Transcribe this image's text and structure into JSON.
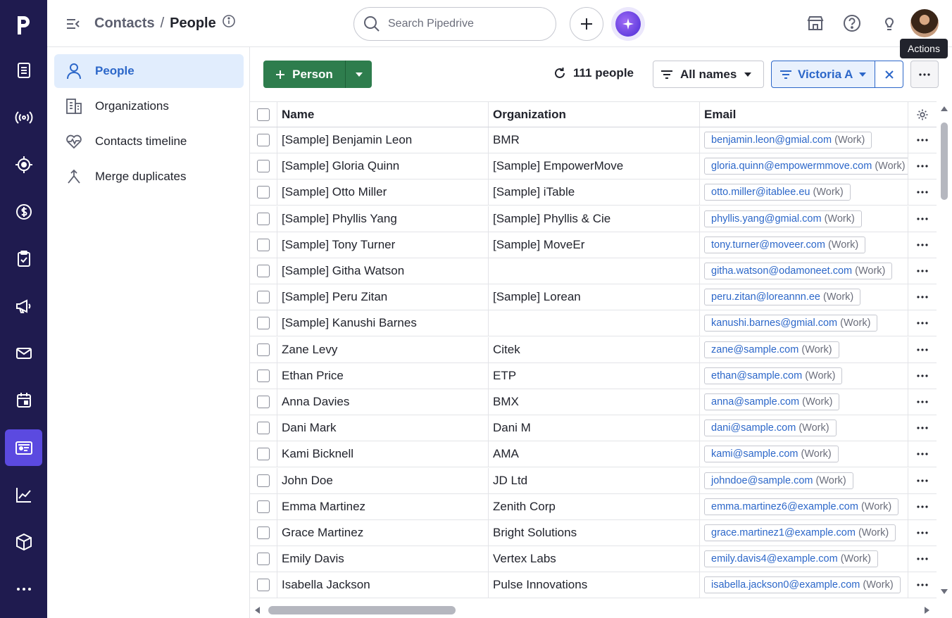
{
  "app": {
    "brand_letter": "p"
  },
  "rail": {
    "items": [
      {
        "name": "leads-icon"
      },
      {
        "name": "campaigns-signal-icon"
      },
      {
        "name": "target-icon"
      },
      {
        "name": "deals-dollar-icon"
      },
      {
        "name": "activities-checklist-icon"
      },
      {
        "name": "megaphone-icon"
      },
      {
        "name": "mail-icon"
      },
      {
        "name": "calendar-icon"
      },
      {
        "name": "contacts-card-icon",
        "active": true
      },
      {
        "name": "insights-chart-icon"
      },
      {
        "name": "products-box-icon"
      },
      {
        "name": "more-dots-icon"
      }
    ]
  },
  "header": {
    "breadcrumb_parent": "Contacts",
    "breadcrumb_sep": "/",
    "breadcrumb_current": "People",
    "search_placeholder": "Search Pipedrive",
    "tooltip": "Actions"
  },
  "sidenav": {
    "items": [
      {
        "label": "People",
        "active": true
      },
      {
        "label": "Organizations"
      },
      {
        "label": "Contacts timeline"
      },
      {
        "label": "Merge duplicates"
      }
    ]
  },
  "toolbar": {
    "add_label": "Person",
    "count_label": "111 people",
    "names_filter": "All names",
    "owner_filter": "Victoria A"
  },
  "table": {
    "columns": {
      "name": "Name",
      "organization": "Organization",
      "email": "Email"
    },
    "email_type": "(Work)",
    "rows": [
      {
        "name": "[Sample] Benjamin Leon",
        "org": "BMR",
        "email": "benjamin.leon@gmial.com"
      },
      {
        "name": "[Sample] Gloria Quinn",
        "org": "[Sample] EmpowerMove",
        "email": "gloria.quinn@empowermmove.com"
      },
      {
        "name": "[Sample] Otto Miller",
        "org": "[Sample] iTable",
        "email": "otto.miller@itablee.eu"
      },
      {
        "name": "[Sample] Phyllis Yang",
        "org": "[Sample] Phyllis & Cie",
        "email": "phyllis.yang@gmial.com"
      },
      {
        "name": "[Sample] Tony Turner",
        "org": "[Sample] MoveEr",
        "email": "tony.turner@moveer.com"
      },
      {
        "name": "[Sample] Githa Watson",
        "org": "",
        "email": "githa.watson@odamoneet.com"
      },
      {
        "name": "[Sample] Peru Zitan",
        "org": "[Sample] Lorean",
        "email": "peru.zitan@loreannn.ee"
      },
      {
        "name": "[Sample] Kanushi Barnes",
        "org": "",
        "email": "kanushi.barnes@gmial.com"
      },
      {
        "name": "Zane Levy",
        "org": "Citek",
        "email": "zane@sample.com"
      },
      {
        "name": "Ethan Price",
        "org": "ETP",
        "email": "ethan@sample.com"
      },
      {
        "name": "Anna Davies",
        "org": "BMX",
        "email": "anna@sample.com"
      },
      {
        "name": "Dani Mark",
        "org": "Dani M",
        "email": "dani@sample.com"
      },
      {
        "name": "Kami Bicknell",
        "org": "AMA",
        "email": "kami@sample.com"
      },
      {
        "name": "John Doe",
        "org": "JD Ltd",
        "email": "johndoe@sample.com"
      },
      {
        "name": "Emma Martinez",
        "org": "Zenith Corp",
        "email": "emma.martinez6@example.com"
      },
      {
        "name": "Grace Martinez",
        "org": "Bright Solutions",
        "email": "grace.martinez1@example.com"
      },
      {
        "name": "Emily Davis",
        "org": "Vertex Labs",
        "email": "emily.davis4@example.com"
      },
      {
        "name": "Isabella Jackson",
        "org": "Pulse Innovations",
        "email": "isabella.jackson0@example.com"
      }
    ]
  },
  "colors": {
    "rail_bg": "#1f1b4f",
    "accent": "#5b4ae0",
    "primary_green": "#2e7d4d",
    "link_blue": "#2c67c9"
  }
}
